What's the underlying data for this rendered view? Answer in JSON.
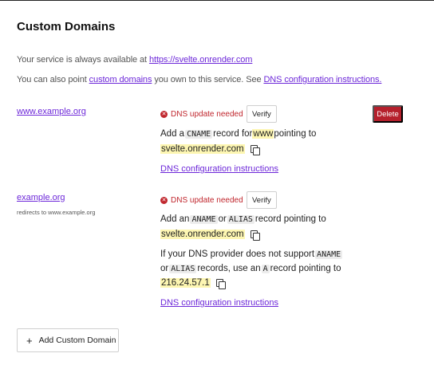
{
  "section": {
    "title": "Custom Domains"
  },
  "intro": {
    "line1_prefix": "Your service is always available at ",
    "line1_link": "https://svelte.onrender.com",
    "line2_prefix": "You can also point ",
    "line2_link1": "custom domains",
    "line2_middle": " you own to this service. See ",
    "line2_link2": "DNS configuration instructions."
  },
  "domains": [
    {
      "name": "www.example.org",
      "status": "DNS update needed",
      "verify_label": "Verify",
      "delete_label": "Delete",
      "instr_prefix": "Add a ",
      "record_type": "CNAME",
      "instr_middle": " record for ",
      "host": "www",
      "instr_suffix": " pointing to",
      "target": "svelte.onrender.com",
      "dns_link": "DNS configuration instructions"
    },
    {
      "name": "example.org",
      "redirect_note": "redirects to www.example.org",
      "status": "DNS update needed",
      "verify_label": "Verify",
      "instr_prefix": "Add an ",
      "record_type1": "ANAME",
      "instr_or": " or ",
      "record_type2": "ALIAS",
      "instr_suffix": " record pointing to",
      "target": "svelte.onrender.com",
      "fallback_line1_prefix": "If your DNS provider does not support ",
      "fallback_type1": "ANAME",
      "fallback_line2_prefix": "or ",
      "fallback_type2": "ALIAS",
      "fallback_line2_middle": " records, use an ",
      "fallback_type3": "A",
      "fallback_line2_suffix": " record pointing to",
      "ip": "216.24.57.1",
      "dns_link": "DNS configuration instructions"
    }
  ],
  "add_button": {
    "icon": "plus-icon",
    "label": "Add Custom Domain"
  },
  "colors": {
    "link": "#6d28d9",
    "error": "#c0262d",
    "delete": "#b5202c",
    "highlight": "#fdf6b2"
  }
}
